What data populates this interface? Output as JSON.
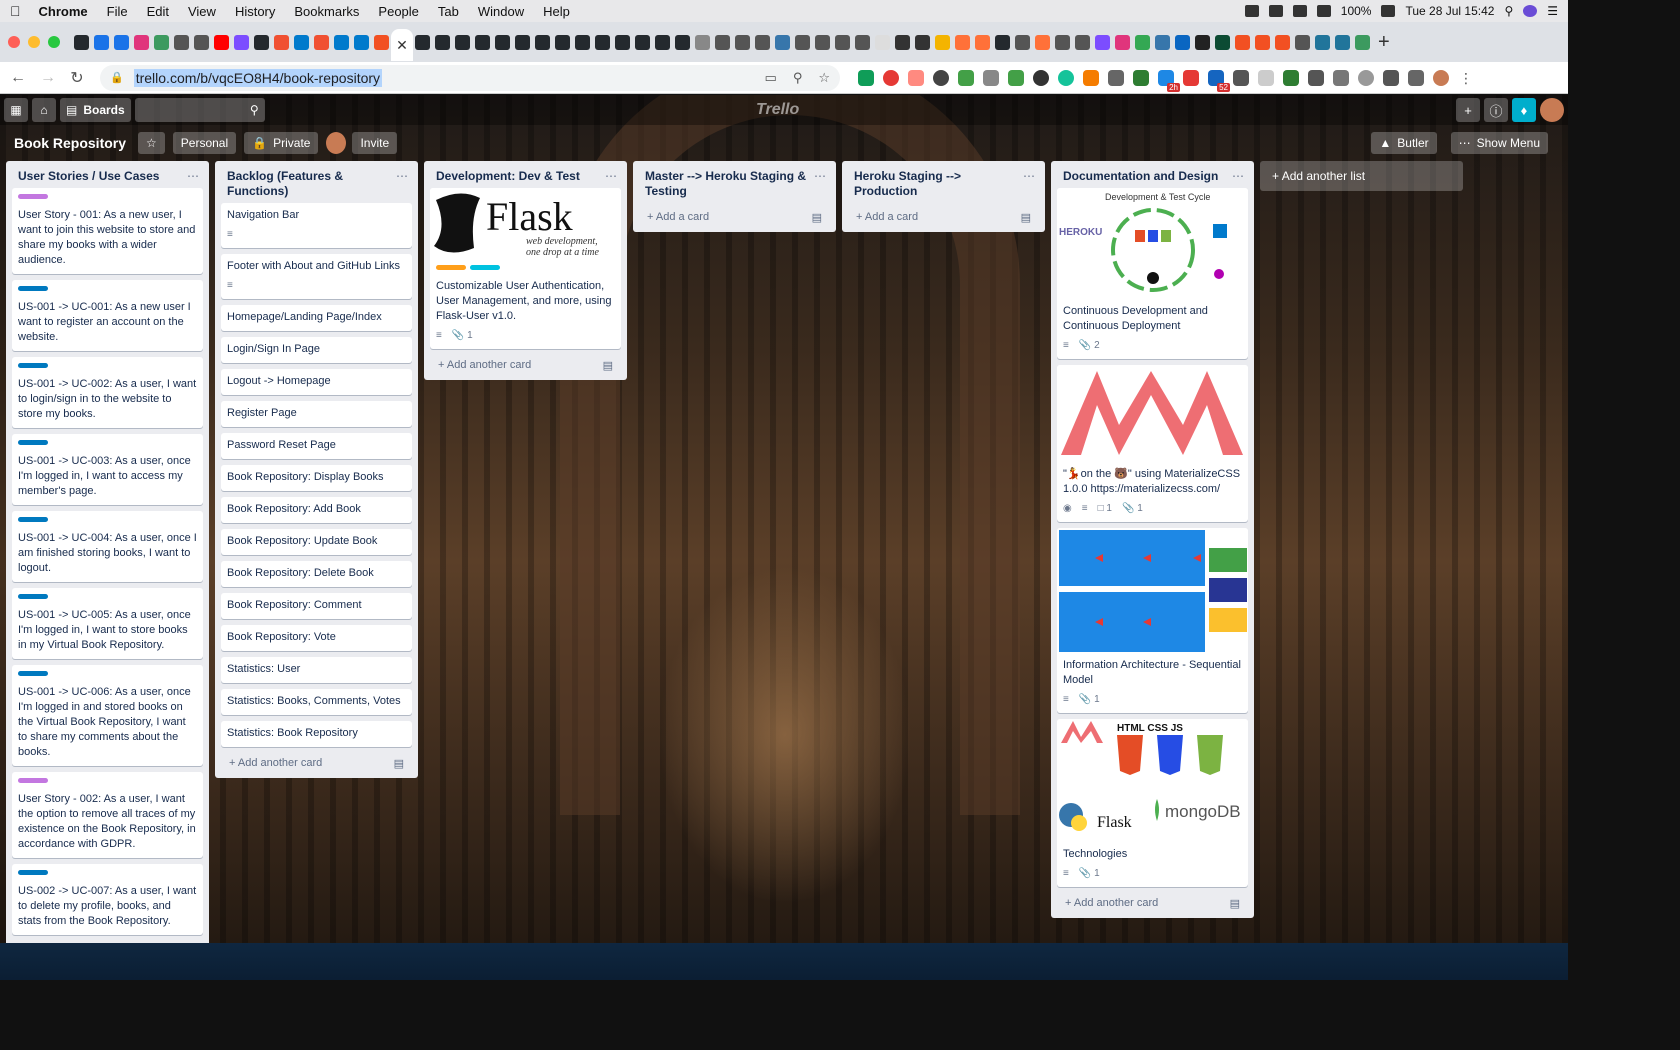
{
  "menubar": {
    "app": "Chrome",
    "items": [
      "File",
      "Edit",
      "View",
      "History",
      "Bookmarks",
      "People",
      "Tab",
      "Window",
      "Help"
    ],
    "battery": "100%",
    "datetime": "Tue 28 Jul  15:42"
  },
  "tabs": {
    "close_glyph": "✕",
    "new_tab_glyph": "+"
  },
  "browser": {
    "url": "trello.com/b/vqcEO8H4/book-repository",
    "badges": {
      "ext_2h": "2h",
      "ext_52": "52"
    }
  },
  "trello": {
    "boards_label": "Boards",
    "logo": "Trello",
    "board_name": "Book Repository",
    "personal": "Personal",
    "private": "Private",
    "invite": "Invite",
    "butler": "Butler",
    "show_menu": "Show Menu",
    "add_another_list": "Add another list",
    "add_another_card": "Add another card",
    "add_a_card": "Add a card"
  },
  "lists": [
    {
      "title": "User Stories / Use Cases",
      "cards": [
        {
          "label_color": "#c377e0",
          "text": "User Story - 001: As a new user, I want to join this website to store and share my books with a wider audience."
        },
        {
          "label_color": "#0079bf",
          "text": "US-001 -> UC-001: As a new user I want to register an account on the website."
        },
        {
          "label_color": "#0079bf",
          "text": "US-001 -> UC-002: As a user, I want to login/sign in to the website to store my books."
        },
        {
          "label_color": "#0079bf",
          "text": "US-001 -> UC-003: As a user, once I'm logged in, I want to access my member's page."
        },
        {
          "label_color": "#0079bf",
          "text": "US-001 -> UC-004: As a user, once I am finished storing books, I want to logout."
        },
        {
          "label_color": "#0079bf",
          "text": "US-001 -> UC-005: As a user, once I'm logged in, I want to store books in my Virtual Book Repository."
        },
        {
          "label_color": "#0079bf",
          "text": "US-001 -> UC-006: As a user, once I'm logged in and stored books on the Virtual Book Repository, I want to share my comments about the books."
        },
        {
          "label_color": "#c377e0",
          "text": "User Story - 002: As a user, I want the option to remove all traces of my existence on the Book Repository, in accordance with GDPR."
        },
        {
          "label_color": "#0079bf",
          "text": "US-002 -> UC-007: As a user, I want to delete my profile, books, and stats from the Book Repository."
        }
      ]
    },
    {
      "title": "Backlog (Features & Functions)",
      "cards": [
        {
          "text": "Navigation Bar",
          "desc": true
        },
        {
          "text": "Footer with About and GitHub Links",
          "desc": true
        },
        {
          "text": "Homepage/Landing Page/Index"
        },
        {
          "text": "Login/Sign In Page"
        },
        {
          "text": "Logout -> Homepage"
        },
        {
          "text": "Register Page"
        },
        {
          "text": "Password Reset Page"
        },
        {
          "text": "Book Repository: Display Books"
        },
        {
          "text": "Book Repository: Add Book"
        },
        {
          "text": "Book Repository: Update Book"
        },
        {
          "text": "Book Repository: Delete Book"
        },
        {
          "text": "Book Repository: Comment"
        },
        {
          "text": "Book Repository: Vote"
        },
        {
          "text": "Statistics: User"
        },
        {
          "text": "Statistics: Books, Comments, Votes"
        },
        {
          "text": "Statistics: Book Repository"
        }
      ]
    },
    {
      "title": "Development: Dev & Test",
      "cards": [
        {
          "cover_title": "Flask",
          "cover_sub1": "web development,",
          "cover_sub2": "one drop at a time",
          "text": "Customizable User Authentication, User Management, and more, using Flask-User v1.0.",
          "attachments": "1"
        }
      ]
    },
    {
      "title": "Master --> Heroku Staging & Testing",
      "cards": []
    },
    {
      "title": "Heroku Staging  --> Production",
      "cards": []
    },
    {
      "title": "Documentation and Design",
      "cards": [
        {
          "cover_title": "Development & Test Cycle",
          "cover_brand": "HEROKU",
          "text": "Continuous Development and Continuous Deployment",
          "attachments": "2"
        },
        {
          "text": "\"💃on the 🐻\" using MaterializeCSS 1.0.0 https://materializecss.com/",
          "comments": "1",
          "attachments": "1"
        },
        {
          "text": "Information Architecture - Sequential Model",
          "attachments": "1"
        },
        {
          "cover_title": "HTML  CSS  JS",
          "cover_brand": "mongoDB",
          "cover_brand2": "Flask",
          "text": "Technologies",
          "attachments": "1"
        }
      ]
    }
  ],
  "colors": {
    "trello_blue": "#0079bf",
    "purple_label": "#c377e0",
    "orange_label": "#ff9f1a",
    "sky_label": "#00c2e0"
  }
}
